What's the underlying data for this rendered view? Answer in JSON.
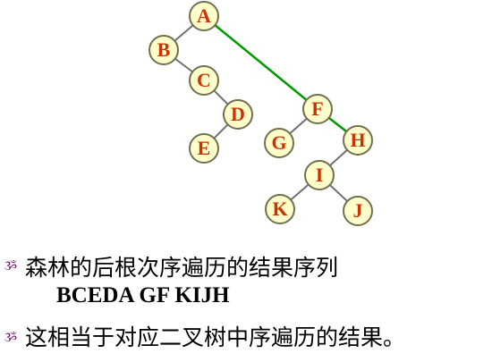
{
  "colors": {
    "node_fill": "#ffffcc",
    "node_stroke": "#707050",
    "node_label": "#cc3300",
    "edge": "#707070",
    "highlight_edge": "#009900",
    "bullet": "#660066",
    "text": "#000000"
  },
  "tree": {
    "nodes": [
      {
        "id": "A",
        "label": "A"
      },
      {
        "id": "B",
        "label": "B"
      },
      {
        "id": "C",
        "label": "C"
      },
      {
        "id": "D",
        "label": "D"
      },
      {
        "id": "E",
        "label": "E"
      },
      {
        "id": "F",
        "label": "F"
      },
      {
        "id": "G",
        "label": "G"
      },
      {
        "id": "H",
        "label": "H"
      },
      {
        "id": "I",
        "label": "I"
      },
      {
        "id": "K",
        "label": "K"
      },
      {
        "id": "J",
        "label": "J"
      }
    ],
    "edges": [
      {
        "from": "A",
        "to": "B",
        "highlight": false
      },
      {
        "from": "B",
        "to": "C",
        "highlight": false
      },
      {
        "from": "C",
        "to": "D",
        "highlight": false
      },
      {
        "from": "D",
        "to": "E",
        "highlight": false
      },
      {
        "from": "A",
        "to": "F",
        "highlight": true
      },
      {
        "from": "F",
        "to": "G",
        "highlight": false
      },
      {
        "from": "F",
        "to": "H",
        "highlight": true
      },
      {
        "from": "H",
        "to": "I",
        "highlight": false
      },
      {
        "from": "I",
        "to": "K",
        "highlight": false
      },
      {
        "from": "I",
        "to": "J",
        "highlight": false
      }
    ]
  },
  "text": {
    "bullet_glyph": "ૐ",
    "line1": "森林的后根次序遍历的结果序列",
    "sequence": "BCEDA GF KIJH",
    "line2": "这相当于对应二叉树中序遍历的结果。"
  }
}
